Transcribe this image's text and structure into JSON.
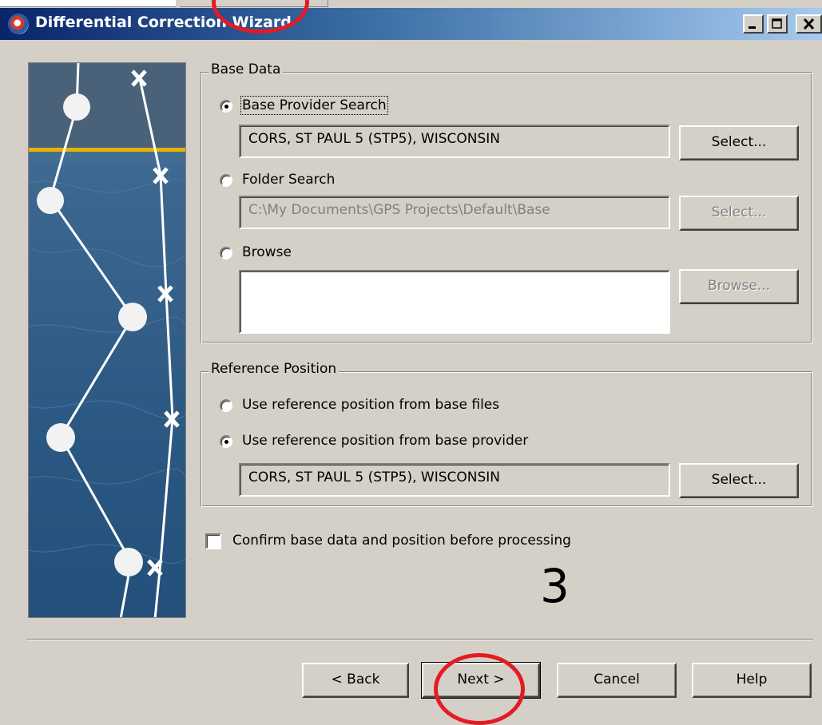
{
  "window": {
    "title": "Differential Correction Wizard"
  },
  "base_data": {
    "legend": "Base Data",
    "provider_search": {
      "label": "Base Provider Search",
      "checked": true,
      "value": "CORS, ST PAUL 5 (STP5),  WISCONSIN",
      "button": "Select..."
    },
    "folder_search": {
      "label": "Folder Search",
      "checked": false,
      "value": "C:\\My Documents\\GPS Projects\\Default\\Base",
      "button": "Select..."
    },
    "browse": {
      "label": "Browse",
      "checked": false,
      "value": "",
      "button": "Browse..."
    }
  },
  "reference_position": {
    "legend": "Reference Position",
    "from_base_files": {
      "label": "Use reference position from base files",
      "checked": false
    },
    "from_base_provider": {
      "label": "Use reference position from base provider",
      "checked": true,
      "value": "CORS, ST PAUL 5 (STP5),  WISCONSIN",
      "button": "Select..."
    }
  },
  "confirm": {
    "label": "Confirm base data and position before processing",
    "checked": false
  },
  "annotation": {
    "step_number": "3",
    "highlight_color": "#e31b23"
  },
  "buttons": {
    "back": "< Back",
    "next": "Next  >",
    "cancel": "Cancel",
    "help": "Help"
  },
  "icons": {
    "app": "differential-correction-icon",
    "minimize": "minimize-icon",
    "maximize": "maximize-icon",
    "close": "close-icon"
  }
}
